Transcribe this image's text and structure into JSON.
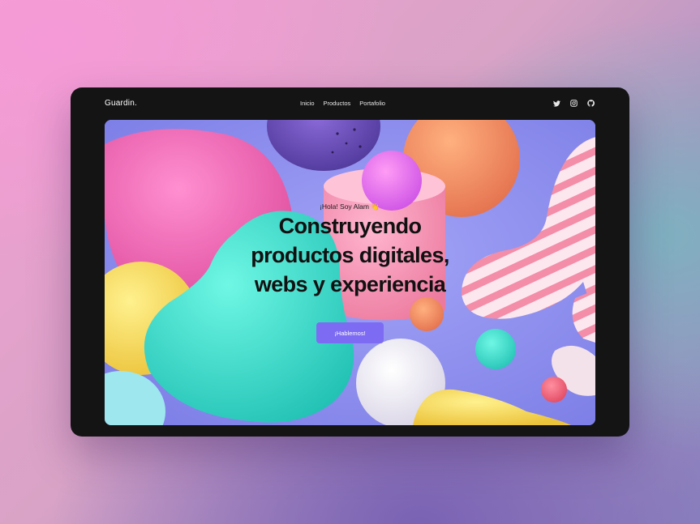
{
  "brand": {
    "name": "Guardin."
  },
  "nav": {
    "items": [
      "Inicio",
      "Productos",
      "Portafolio"
    ]
  },
  "socials": [
    "twitter-icon",
    "instagram-icon",
    "github-icon"
  ],
  "hero": {
    "greeting": "¡Hola! Soy Alam 👋",
    "headline": [
      "Construyendo",
      "productos digitales,",
      "webs y experiencia"
    ],
    "cta_label": "¡Hablemos!"
  },
  "colors": {
    "frame": "#141414",
    "cta": "#7d6cf3",
    "hero_background": "#8f8ef0"
  }
}
